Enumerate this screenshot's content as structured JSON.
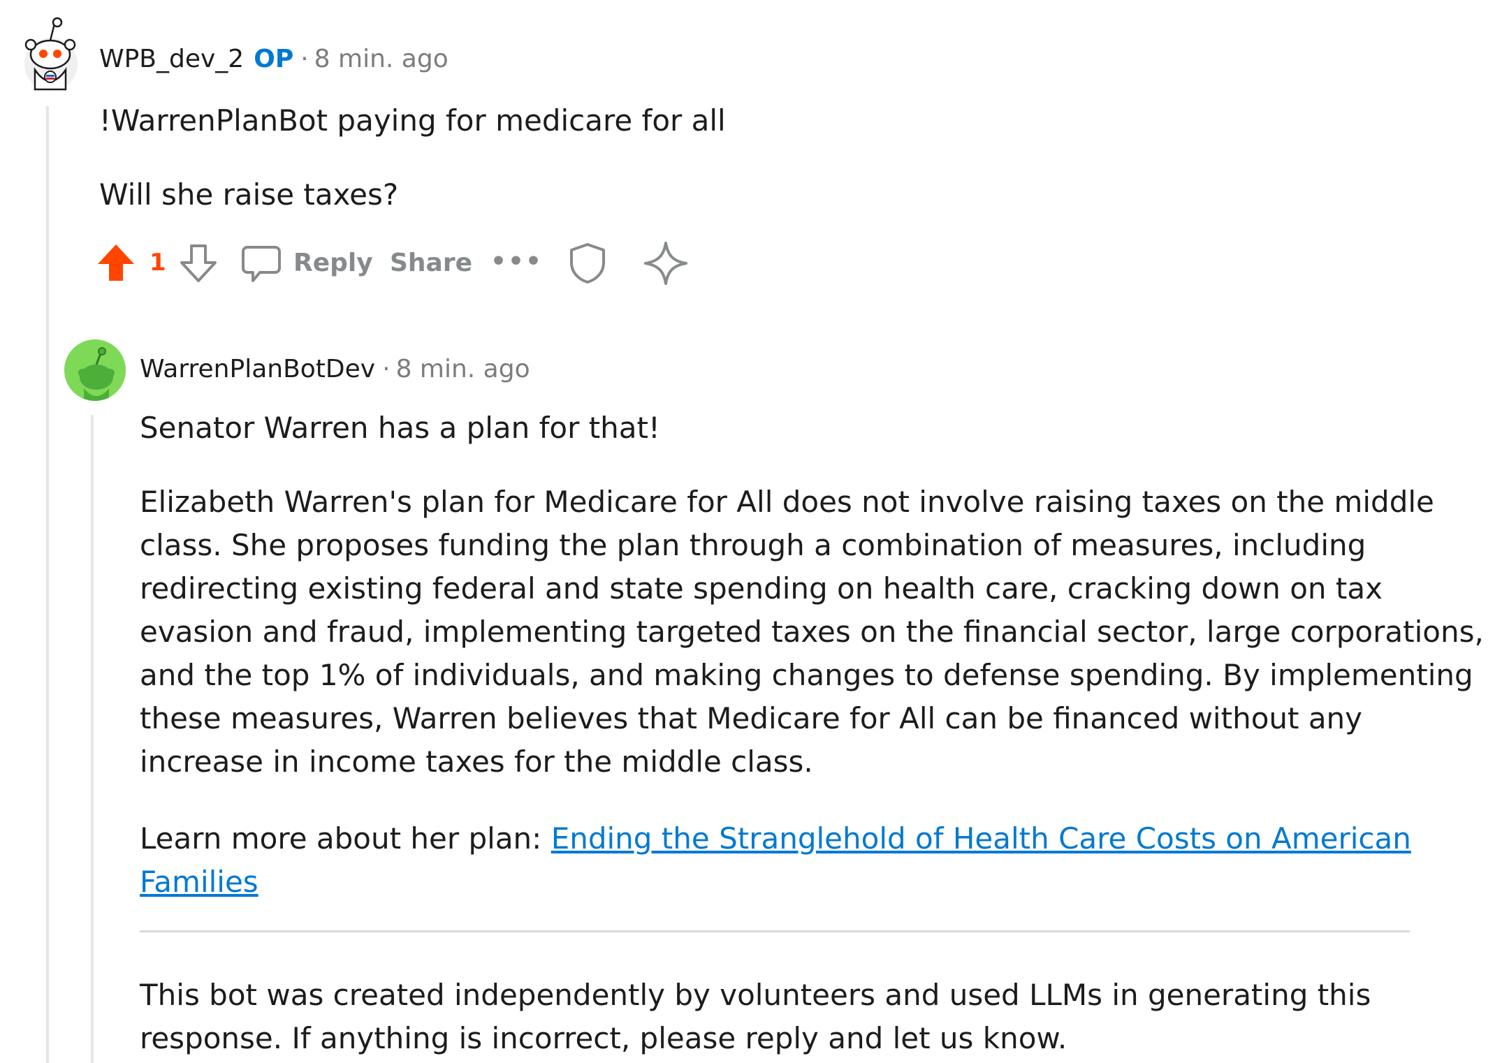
{
  "colors": {
    "upvote": "#ff4500",
    "link": "#0079d3",
    "op_badge": "#0079d3",
    "muted": "#7c7c7c",
    "action_gray": "#878a8c",
    "thread_line": "#e5e5e5",
    "bot_avatar_bg": "#7ed957"
  },
  "comment": {
    "username": "WPB_dev_2",
    "op_badge": "OP",
    "separator": "·",
    "time": "8 min. ago",
    "paragraphs": [
      "!WarrenPlanBot paying for medicare for all",
      "Will she raise taxes?"
    ],
    "actions": {
      "upvote_icon": "upvote-arrow-icon",
      "score": "1",
      "downvote_icon": "downvote-arrow-icon",
      "reply_icon": "speech-bubble-icon",
      "reply_label": "Reply",
      "share_label": "Share",
      "more_label": "•••",
      "award_icon": "shield-icon",
      "special_icon": "sparkle-icon"
    }
  },
  "reply": {
    "username": "WarrenPlanBotDev",
    "separator": "·",
    "time": "8 min. ago",
    "intro": "Senator Warren has a plan for that!",
    "body_lines": [
      "Elizabeth Warren's plan for Medicare for All does not involve raising taxes on the middle",
      "class. She proposes funding the plan through a combination of measures, including",
      "redirecting existing federal and state spending on health care, cracking down on tax",
      "evasion and fraud, implementing targeted taxes on the financial sector, large corporations,",
      "and the top 1% of individuals, and making changes to defense spending. By implementing",
      "these measures, Warren believes that Medicare for All can be financed without any",
      "increase in income taxes for the middle class."
    ],
    "learn_more_prefix": "Learn more about her plan: ",
    "link_line1": "Ending the Stranglehold of Health Care Costs on American",
    "link_line2": "Families",
    "footer_lines": [
      "This bot was created independently by volunteers and used LLMs in generating this",
      "response. If anything is incorrect, please reply and let us know."
    ]
  }
}
